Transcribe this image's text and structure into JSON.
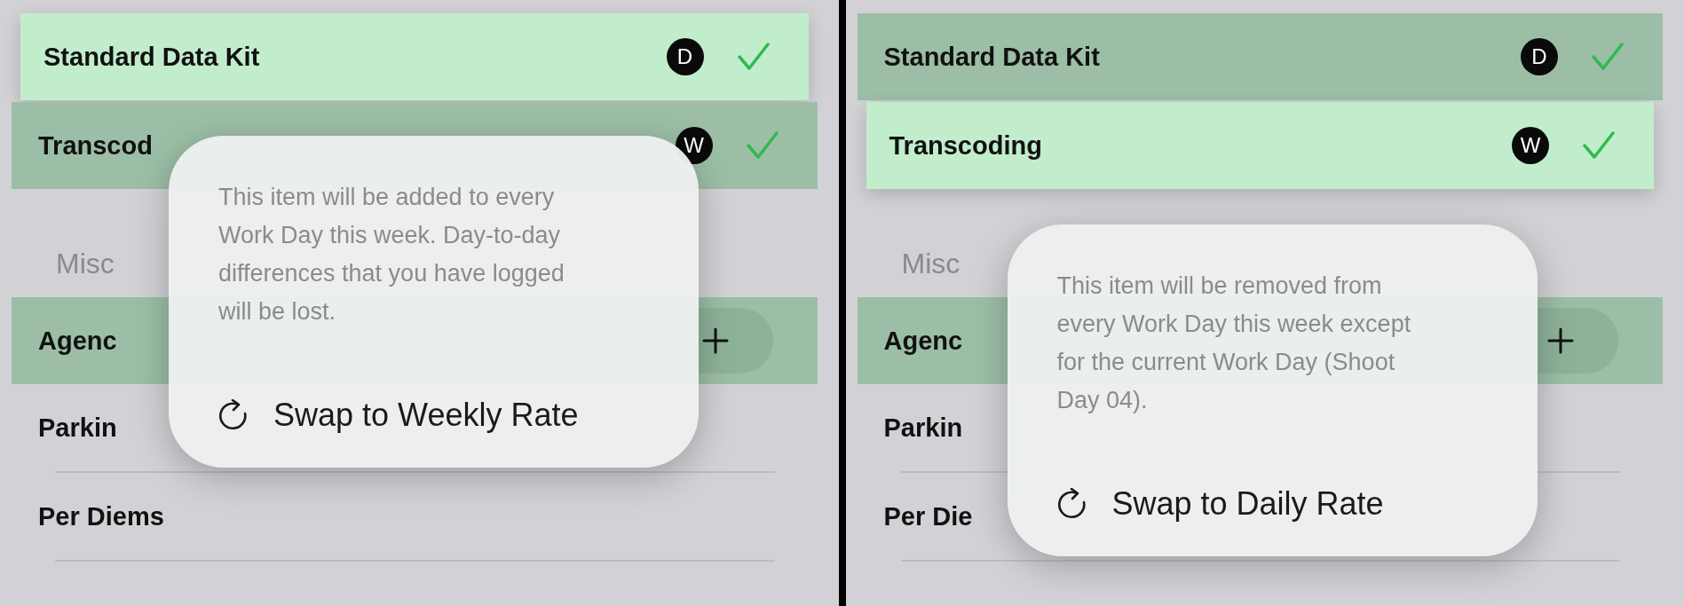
{
  "panels": [
    {
      "top_rows": [
        {
          "label": "Standard Data Kit",
          "badge": "D",
          "checked": true,
          "selected": true
        },
        {
          "label": "Transcod",
          "badge": "W",
          "checked": true,
          "selected": false
        }
      ],
      "section": {
        "title": "Misc",
        "rows": [
          {
            "label": "Agenc",
            "kind": "add",
            "highlighted": true
          },
          {
            "label": "Parkin",
            "kind": "plain",
            "highlighted": false
          },
          {
            "label": "Per Diems",
            "kind": "plain",
            "highlighted": false
          }
        ]
      },
      "popup": {
        "message": "This item will be added to every Work Day this week. Day-to-day differences that you have logged will be lost.",
        "action": "Swap to Weekly Rate"
      }
    },
    {
      "top_rows": [
        {
          "label": "Standard Data Kit",
          "badge": "D",
          "checked": true,
          "selected": false
        },
        {
          "label": "Transcoding",
          "badge": "W",
          "checked": true,
          "selected": true
        }
      ],
      "section": {
        "title": "Misc",
        "rows": [
          {
            "label": "Agenc",
            "kind": "add",
            "highlighted": true
          },
          {
            "label": "Parkin",
            "kind": "plain",
            "highlighted": false
          },
          {
            "label": "Per Die",
            "kind": "plain",
            "highlighted": false
          }
        ]
      },
      "popup": {
        "message": "This item will be removed from every Work Day this week except for the current Work Day (Shoot Day 04).",
        "action": "Swap to Daily Rate"
      }
    }
  ]
}
